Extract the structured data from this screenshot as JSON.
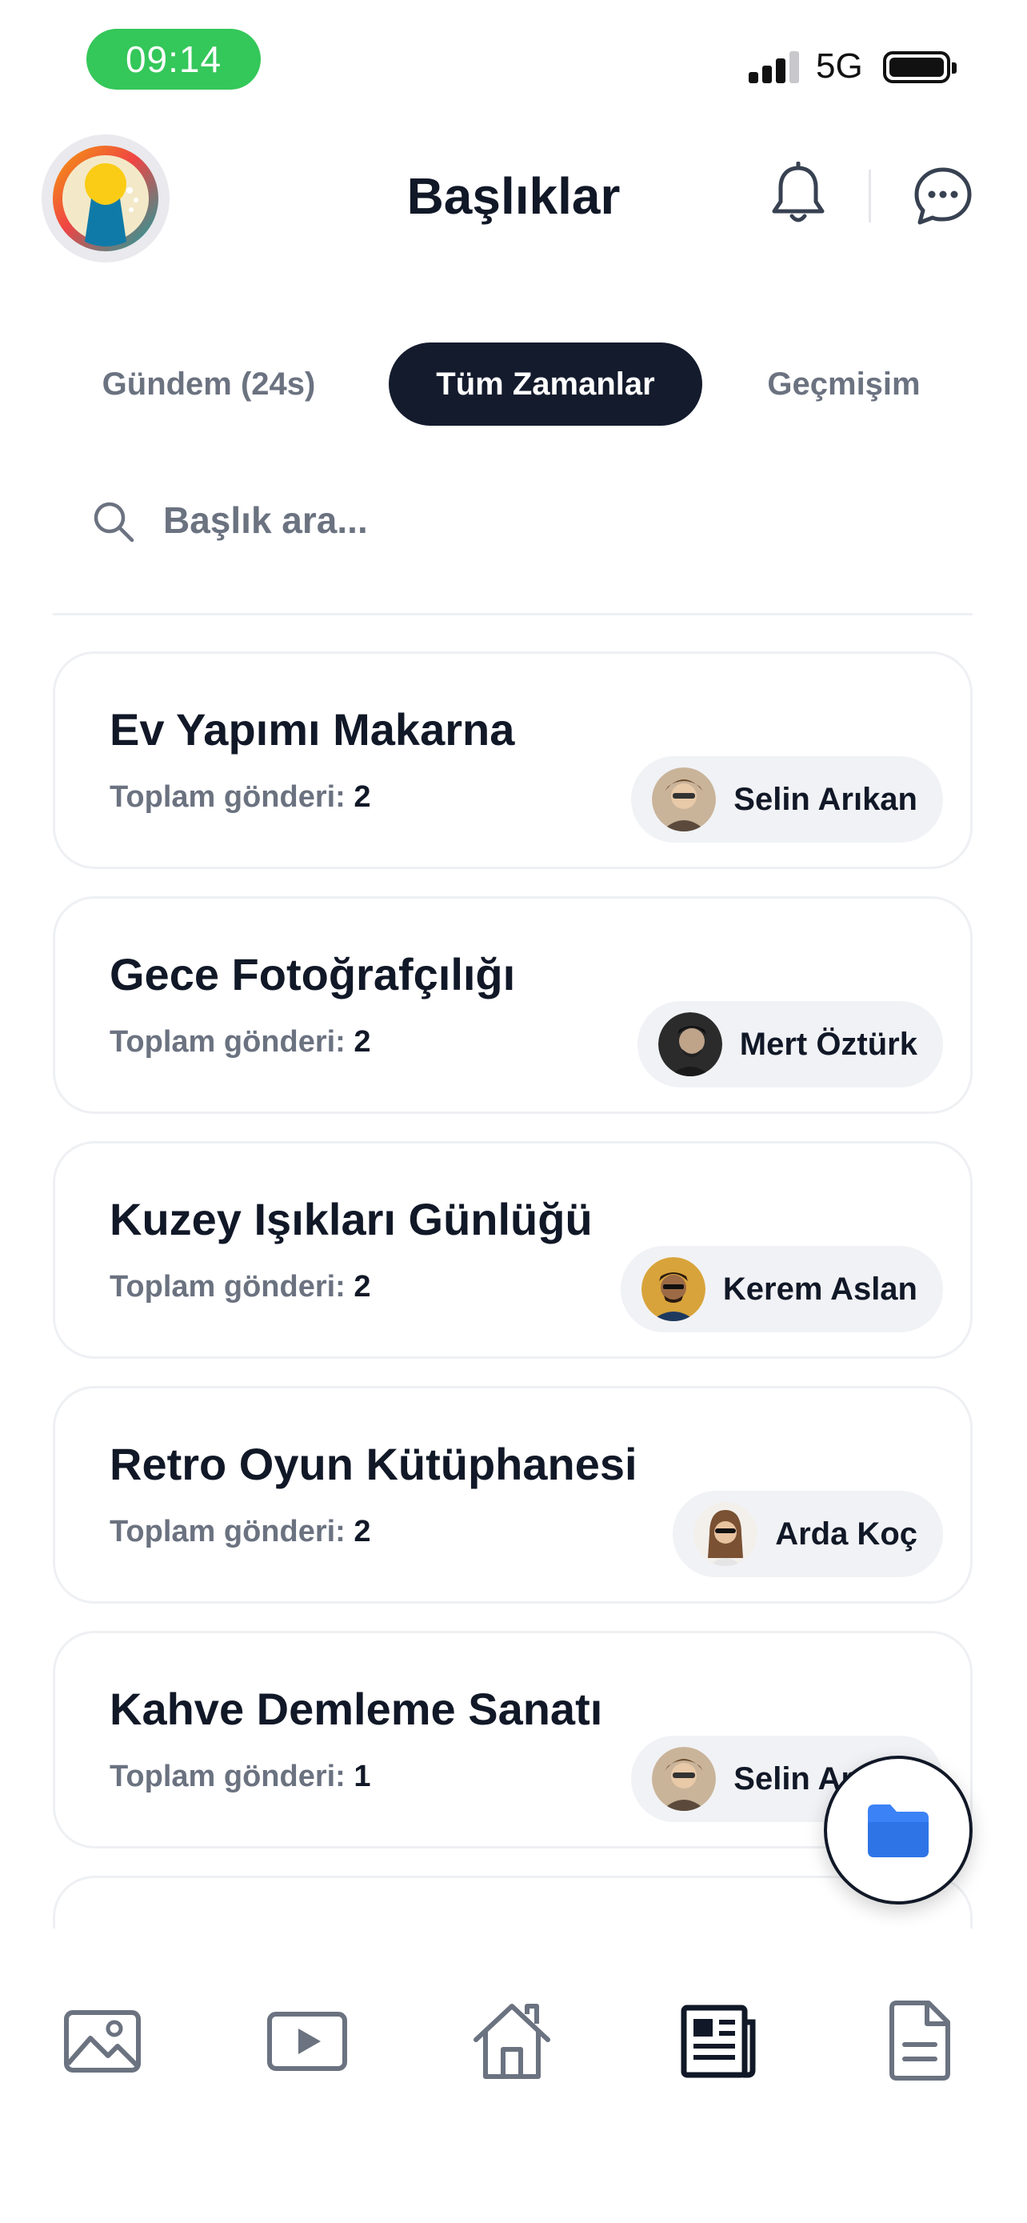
{
  "status_bar": {
    "time": "09:14",
    "network": "5G"
  },
  "header": {
    "title": "Başlıklar",
    "icons": [
      "app-logo",
      "bell-icon",
      "chat-icon"
    ]
  },
  "tabs": [
    {
      "label": "Gündem (24s)",
      "active": false
    },
    {
      "label": "Tüm Zamanlar",
      "active": true
    },
    {
      "label": "Geçmişim",
      "active": false
    }
  ],
  "search": {
    "placeholder": "Başlık ara..."
  },
  "topics": [
    {
      "title": "Ev Yapımı Makarna",
      "count_label": "Toplam gönderi:",
      "count": "2",
      "author": "Selin Arıkan"
    },
    {
      "title": "Gece Fotoğrafçılığı",
      "count_label": "Toplam gönderi:",
      "count": "2",
      "author": "Mert Öztürk"
    },
    {
      "title": "Kuzey Işıkları Günlüğü",
      "count_label": "Toplam gönderi:",
      "count": "2",
      "author": "Kerem Aslan"
    },
    {
      "title": "Retro Oyun Kütüphanesi",
      "count_label": "Toplam gönderi:",
      "count": "2",
      "author": "Arda Koç"
    },
    {
      "title": "Kahve Demleme Sanatı",
      "count_label": "Toplam gönderi:",
      "count": "1",
      "author": "Selin Arıkan"
    }
  ],
  "fab": {
    "icon": "folder-icon"
  },
  "bottom_nav": [
    {
      "icon": "image-icon",
      "active": false
    },
    {
      "icon": "video-icon",
      "active": false
    },
    {
      "icon": "home-icon",
      "active": false
    },
    {
      "icon": "newspaper-icon",
      "active": true
    },
    {
      "icon": "document-icon",
      "active": false
    }
  ],
  "colors": {
    "primary_dark": "#141b2d",
    "status_green": "#34c759",
    "muted_text": "#6b7280",
    "card_border": "#eef0f3",
    "chip_bg": "#f1f2f5",
    "folder_blue": "#3b82f6",
    "nav_icon": "#6b7280"
  }
}
